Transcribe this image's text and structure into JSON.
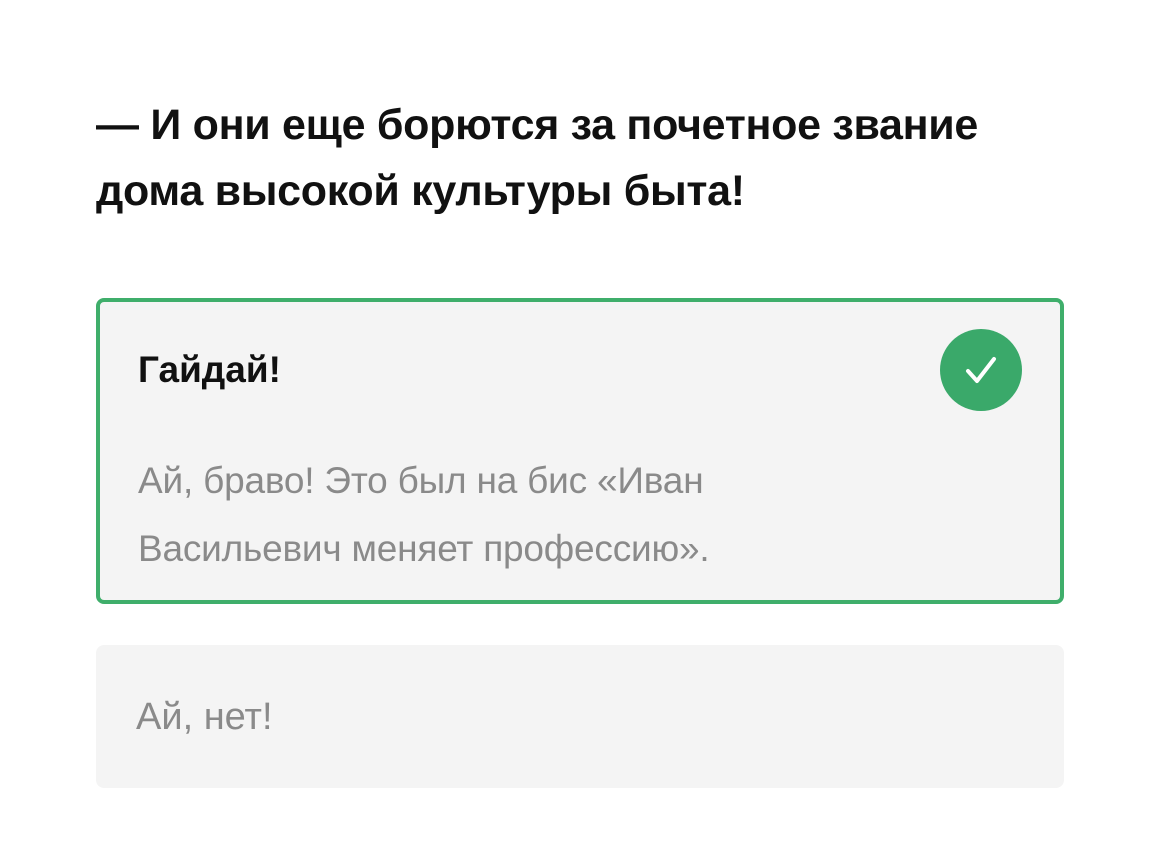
{
  "question": {
    "text": "— И они еще борются за почетное звание дома высокой культуры быта!"
  },
  "options": [
    {
      "title": "Гайдай!",
      "explanation": "Ай, браво! Это был на бис «Иван Васильевич меняет профессию».",
      "state": "correct",
      "icon": "check-icon",
      "accent_color": "#3aa96a"
    },
    {
      "title": "Ай, нет!",
      "state": "unselected"
    }
  ]
}
